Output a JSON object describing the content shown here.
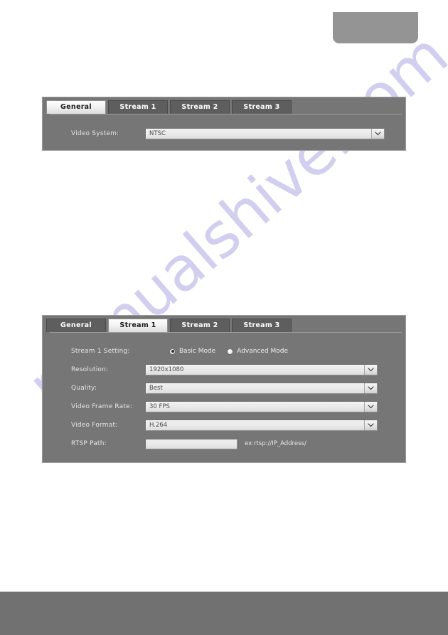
{
  "watermark": {
    "text": "manualshive.com"
  },
  "panels": {
    "general": {
      "tabs": [
        {
          "label": "General",
          "active": true
        },
        {
          "label": "Stream 1",
          "active": false
        },
        {
          "label": "Stream 2",
          "active": false
        },
        {
          "label": "Stream 3",
          "active": false
        }
      ],
      "fields": [
        {
          "label": "Video System:",
          "value": "NTSC"
        }
      ]
    },
    "stream1": {
      "tabs": [
        {
          "label": "General",
          "active": false
        },
        {
          "label": "Stream 1",
          "active": true
        },
        {
          "label": "Stream 2",
          "active": false
        },
        {
          "label": "Stream 3",
          "active": false
        }
      ],
      "setting_label": "Stream 1 Setting:",
      "modes": [
        {
          "label": "Basic Mode",
          "checked": true
        },
        {
          "label": "Advanced Mode",
          "checked": false
        }
      ],
      "fields": [
        {
          "label": "Resolution:",
          "value": "1920x1080"
        },
        {
          "label": "Quality:",
          "value": "Best"
        },
        {
          "label": "Video Frame Rate:",
          "value": "30 FPS"
        },
        {
          "label": "Video Format:",
          "value": "H.264"
        }
      ],
      "rtsp": {
        "label": "RTSP Path:",
        "value": "",
        "placeholder": "",
        "hint": "ex:rtsp://IP_Address/"
      }
    }
  },
  "colors": {
    "panel_bg": "#767676",
    "tab_inactive": "#5e5e5e",
    "footer": "#717171",
    "corner_block": "#949494",
    "watermark": "#c9c6ee"
  }
}
